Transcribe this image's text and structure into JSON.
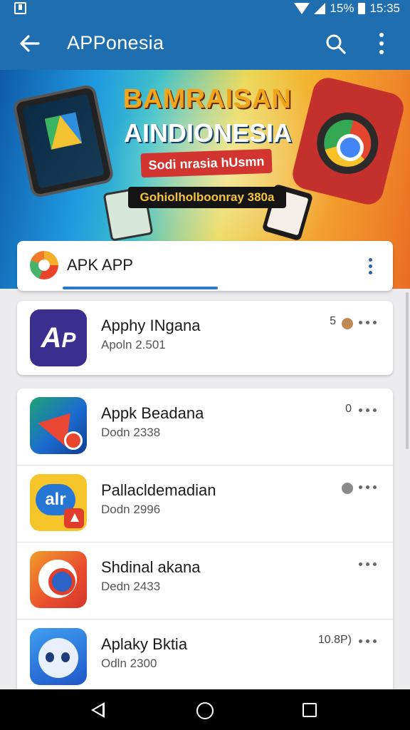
{
  "status_bar": {
    "battery": "15%",
    "time": "15:35"
  },
  "app_bar": {
    "title": "APPonesia"
  },
  "banner": {
    "headline_1": "BAMRAISAN",
    "headline_2": "AINDIONESIA",
    "pill_text": "Sodi nrasia hUsmn",
    "strip_text": "Gohiolholboonray 380a"
  },
  "category": {
    "title": "APK APP"
  },
  "apps": [
    {
      "name": "Apphy INgana",
      "sub": "Apoln 2.501",
      "badge": "5",
      "dot_color": "#c08a55"
    },
    {
      "name": "Appk Beadana",
      "sub": "Dodn 2338",
      "badge": "0",
      "dot_color": ""
    },
    {
      "name": "Pallacldemadian",
      "sub": "Dodn 2996",
      "badge": "",
      "dot_color": "#8a8a8a"
    },
    {
      "name": "Shdinal akana",
      "sub": "Dedn 2433",
      "badge": "",
      "dot_color": ""
    },
    {
      "name": "Aplaky Bktia",
      "sub": "Odln 2300",
      "badge": "10.8P)",
      "dot_color": ""
    }
  ],
  "icons": {
    "back": "arrow-left-icon",
    "search": "search-icon",
    "more": "more-vert-icon",
    "nav_back": "triangle-back-icon",
    "nav_home": "circle-home-icon",
    "nav_recent": "square-recent-icon"
  },
  "colors": {
    "primary": "#1f6fb0",
    "accent": "#2a7ac7",
    "background": "#ececee"
  }
}
